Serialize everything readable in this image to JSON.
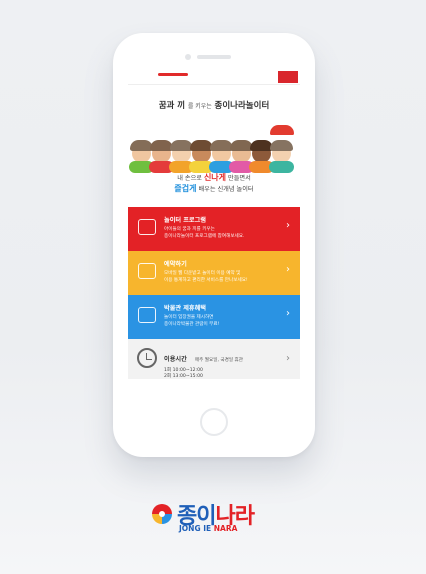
{
  "header": {
    "headline_big": "꿈과 끼",
    "headline_small": "를 키우는",
    "headline_brand": "종이나라놀이터"
  },
  "tagline": {
    "line1_pre": "내 손으로",
    "line1_red": "신나게",
    "line1_post": "만들면서",
    "line2_blue": "즐겁게",
    "line2_post": "배우는 신개념 놀이터"
  },
  "menu": [
    {
      "title": "놀이터 프로그램",
      "desc_line1": "아이들의 꿈과 끼를 키우는",
      "desc_line2": "종이나라놀이터 프로그램에 참여해보세요.",
      "color": "#e32226",
      "icon": "pencil-icon"
    },
    {
      "title": "예약하기",
      "desc_line1": "모바일 웹 다운받고 놀이터 이용 예약 및",
      "desc_line2": "이용 통계하고 편리한 서비스를 만나보세요!",
      "color": "#f7b52d",
      "icon": "calendar-icon"
    },
    {
      "title": "박물관 제휴혜택",
      "desc_line1": "놀이터 입장권을 제시하면",
      "desc_line2": "종이나라박물관 관람이 무료!",
      "color": "#2a93e3",
      "icon": "handshake-icon"
    }
  ],
  "hours": {
    "title": "이용시간",
    "note": "매주 월요일, 국경일 휴관",
    "time1": "1회 10:00~12:00",
    "time2": "2회 13:00~15:00"
  },
  "brand": {
    "ko_blue": "종이",
    "ko_red": "나라",
    "en_blue": "JONG IE",
    "en_red": "NARA"
  }
}
